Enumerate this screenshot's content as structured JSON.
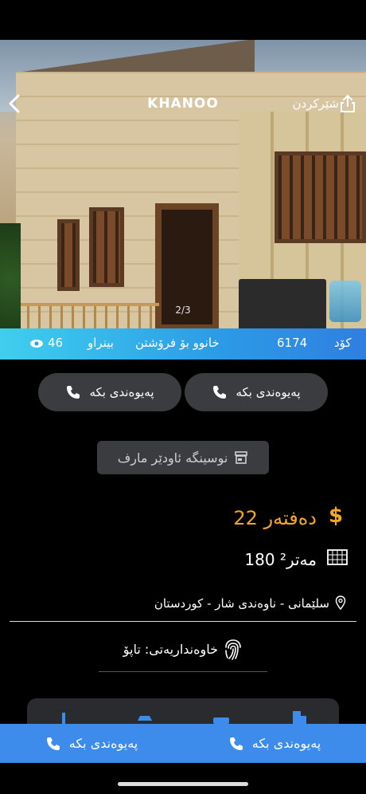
{
  "header": {
    "brand": "KHANOO",
    "share_label": "شێرکردن",
    "photo_counter": "2/3"
  },
  "info_strip": {
    "views_count": "46",
    "views_label": "بینراو",
    "listing_title": "خانوو بۆ فرۆشتن",
    "code_label": "کۆد",
    "code_value": "6174"
  },
  "contact_buttons": {
    "left_label": "پەیوەندی بکە",
    "right_label": "پەیوەندی بکە"
  },
  "agency": {
    "name": "نوسینگە ئاودێر مارف"
  },
  "details": {
    "price": "22 دەفتەر",
    "currency_symbol": "$",
    "area": "180 مەتر²",
    "location": "سلێمانی - ناوەندی شار - کوردستان",
    "ownership": "خاوەنداریەتی: تاپۆ"
  },
  "bottom_bar": {
    "left_label": "پەیوەندی بکە",
    "right_label": "پەیوەندی بکە"
  },
  "colors": {
    "accent": "#3d8bea",
    "price": "#f5a623",
    "strip_start": "#3fcfee",
    "strip_end": "#2f7fe0"
  },
  "icons": [
    "back-icon",
    "share-icon",
    "eye-icon",
    "phone-icon",
    "shop-icon",
    "dollar-icon",
    "area-icon",
    "pin-icon",
    "fingerprint-icon"
  ]
}
